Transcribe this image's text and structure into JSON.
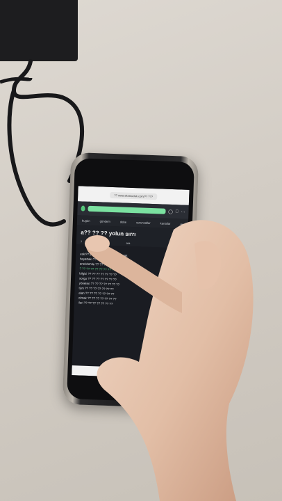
{
  "browser": {
    "url": "?? www.eksisozluk.com/?? ???"
  },
  "site": {
    "nav": [
      "bugün",
      "gündem",
      "debe",
      "sorunsallar",
      "kanallar",
      "•••"
    ]
  },
  "topic": {
    "title": "a?? ?? ?? yolun sırrı",
    "sort": "?",
    "search": "ara",
    "follow": "takip et"
  },
  "entry": {
    "lines": [
      "eski?? ye ?? ?? ?? ?? ?? ?? ??cak",
      "hayattaki ?? ?? ?? ?? ?? ?? ??",
      "anekdot'de ?? ?? ?? ?? ?? ?? ??",
      "? ?? ?? ?? ?? ?? ?? ?? ??",
      "bilgisi ?? ?? ?? ?? ?? ?? ??",
      "sorgu ?? ?? ?? ?? ?? ?? ??",
      "yöneten ?? ?? ?? ?? ?? ?? ??",
      "tüm ?? ?? ?? ?? ?? ?? ??",
      "alan ?? ?? ?? ?? ?? ?? ??",
      "olmak ?? ?? ?? ?? ?? ?? ??",
      "ileri ?? ?? ?? ?? ?? ?? ??"
    ],
    "meta": "?? ?? ?? ??"
  },
  "colors": {
    "wall": "#d8d3cb",
    "charger": "#1d1d1f",
    "cable": "#18181a",
    "skin": "#e8c9b4",
    "site_green": "#61d08a",
    "site_dark": "#1a1c22"
  }
}
